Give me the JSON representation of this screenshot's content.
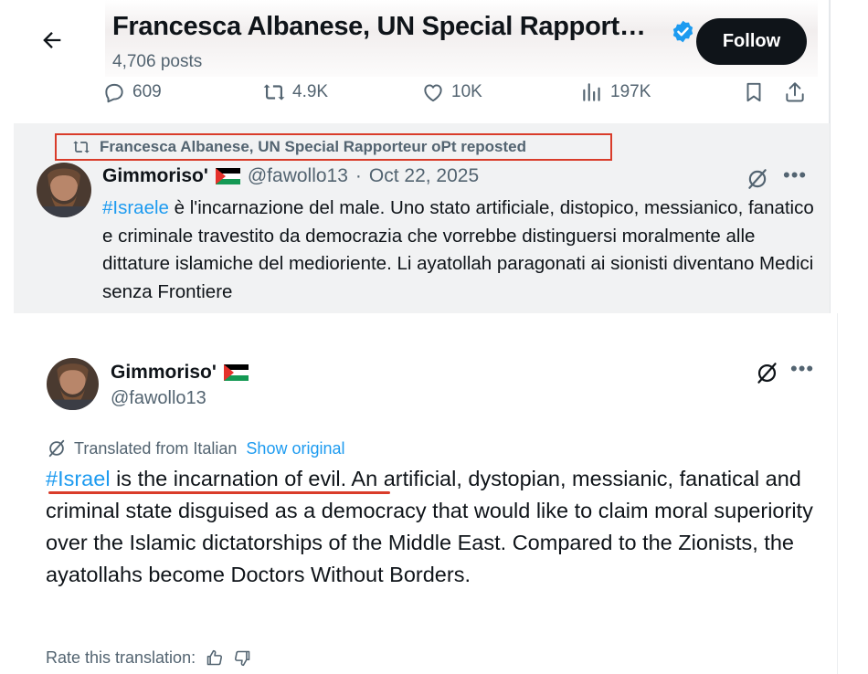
{
  "header": {
    "profile_name": "Francesca Albanese, UN Special Rapport…",
    "posts_count": "4,706 posts",
    "follow_label": "Follow"
  },
  "actions": {
    "replies": "609",
    "reposts": "4.9K",
    "likes": "10K",
    "views": "197K"
  },
  "repost_banner": {
    "text": "Francesca Albanese, UN Special Rapporteur oPt reposted",
    "highlight_color": "#d93c2a"
  },
  "tweet": {
    "author_name": "Gimmoriso'",
    "author_handle": "@fawollo13",
    "date_sep": "·",
    "date": "Oct 22, 2025",
    "hashtag_it": "#Israele",
    "text_it": " è l'incarnazione del male. Uno stato artificiale, distopico, messianico, fanatico e criminale travestito da democrazia che vorrebbe distinguersi moralmente alle dittature islamiche del medioriente. Li ayatollah paragonati ai sionisti diventano Medici senza Frontiere"
  },
  "translated": {
    "author_name": "Gimmoriso'",
    "author_handle": "@fawollo13",
    "translated_label": "Translated from Italian",
    "show_original_label": "Show original",
    "hashtag_en": "#Israel",
    "text_en": " is the incarnation of evil. An artificial, dystopian, messianic, fanatical and criminal state disguised as a democracy that would like to claim moral superiority over the Islamic dictatorships of the Middle East. Compared to the Zionists, the ayatollahs become Doctors Without Borders.",
    "rate_label": "Rate this translation:"
  },
  "colors": {
    "link": "#1d9bf0",
    "verified": "#1d9bf0",
    "muted": "#536471",
    "annotation_red": "#d93c2a"
  },
  "icons": [
    "back-arrow-icon",
    "verified-badge-icon",
    "reply-icon",
    "repost-icon",
    "like-icon",
    "views-icon",
    "bookmark-icon",
    "share-icon",
    "grok-icon",
    "more-icon",
    "translate-icon",
    "thumbs-up-icon",
    "thumbs-down-icon",
    "palestine-flag-icon"
  ]
}
